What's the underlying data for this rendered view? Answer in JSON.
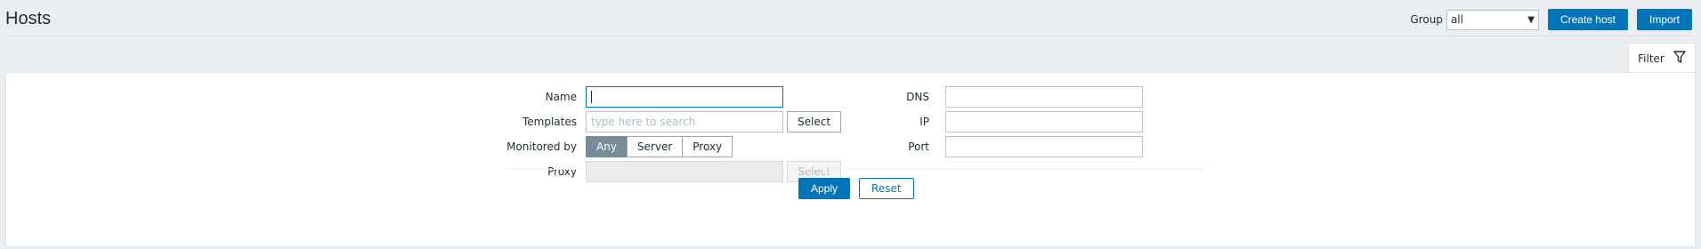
{
  "page": {
    "title": "Hosts"
  },
  "header": {
    "group_label": "Group",
    "group_value": "all",
    "create_host_label": "Create host",
    "import_label": "Import"
  },
  "filter": {
    "tab_label": "Filter",
    "name": {
      "label": "Name",
      "value": ""
    },
    "templates": {
      "label": "Templates",
      "placeholder": "type here to search",
      "select_label": "Select"
    },
    "monitored_by": {
      "label": "Monitored by",
      "options": [
        "Any",
        "Server",
        "Proxy"
      ],
      "selected": "Any"
    },
    "proxy": {
      "label": "Proxy",
      "value": "",
      "select_label": "Select"
    },
    "dns": {
      "label": "DNS",
      "value": ""
    },
    "ip": {
      "label": "IP",
      "value": ""
    },
    "port": {
      "label": "Port",
      "value": ""
    },
    "apply_label": "Apply",
    "reset_label": "Reset"
  },
  "colors": {
    "accent": "#0275b8",
    "segment_active": "#768d99",
    "background": "#ebeef0"
  },
  "icons": {
    "filter": "filter-icon",
    "dropdown": "chevron-down-icon"
  }
}
